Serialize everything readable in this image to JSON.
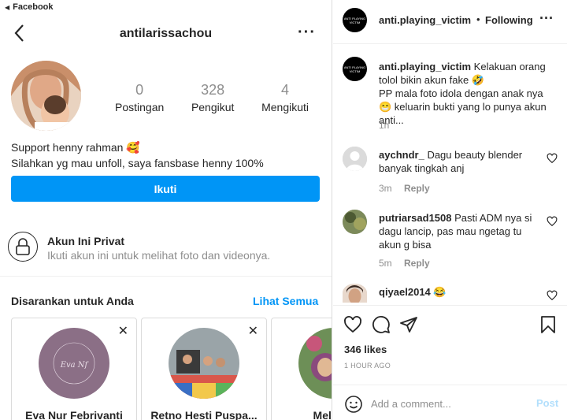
{
  "status_bar": {
    "app": "Facebook"
  },
  "profile": {
    "username": "antilarissachou",
    "stats": [
      {
        "value": "0",
        "label": "Postingan"
      },
      {
        "value": "328",
        "label": "Pengikut"
      },
      {
        "value": "4",
        "label": "Mengikuti"
      }
    ],
    "bio_line1": "Support henny rahman 🥰",
    "bio_line2": "Silahkan yg mau unfoll, saya fansbase henny 100%",
    "follow_label": "Ikuti",
    "private_title": "Akun Ini Privat",
    "private_subtitle": "Ikuti akun ini untuk melihat foto dan videonya."
  },
  "suggestions": {
    "title": "Disarankan untuk Anda",
    "see_all": "Lihat Semua",
    "close_glyph": "✕",
    "cards": [
      {
        "name": "Eva Nur Febrivanti",
        "avatar_text": "Eva Nf"
      },
      {
        "name": "Retno Hesti Puspa..."
      },
      {
        "name": "Melda S"
      }
    ]
  },
  "post": {
    "author": "anti.playing_victim",
    "separator": "•",
    "following_label": "Following",
    "avatar_text": "ANTI PLAYING VICTIM",
    "caption_line1": "Kelakuan orang tolol bikin akun fake 🤣",
    "caption_line2": "PP mala foto idola dengan anak nya 😁 keluarin bukti yang lo punya akun anti...",
    "caption_time": "1h",
    "comments": [
      {
        "user": "aychndr_",
        "text": "Dagu beauty blender banyak tingkah anj",
        "time": "3m",
        "reply": "Reply"
      },
      {
        "user": "putriarsad1508",
        "text": "Pasti ADM nya si dagu lancip, pas mau ngetag tu akun g bisa",
        "time": "5m",
        "reply": "Reply"
      },
      {
        "user": "qiyael2014",
        "text": "😂"
      }
    ],
    "likes": "346 likes",
    "time": "1 HOUR AGO",
    "comment_placeholder": "Add a comment...",
    "post_label": "Post"
  },
  "colors": {
    "primary_blue": "#0095f6",
    "muted": "#8e8e8e",
    "text": "#262626"
  }
}
